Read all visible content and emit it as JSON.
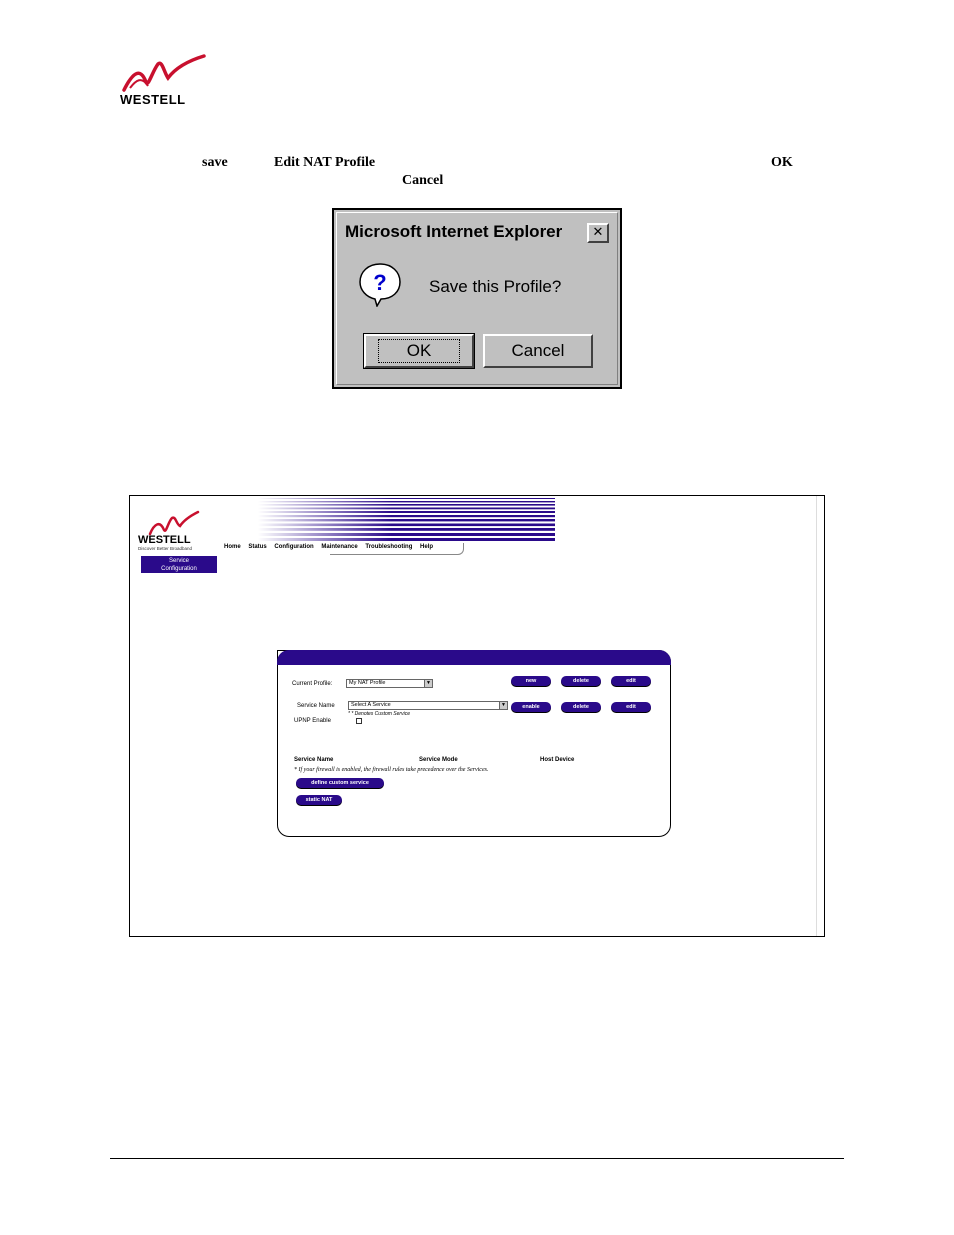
{
  "doc": {
    "logo_word": "WESTELL",
    "word_save": "save",
    "word_edit_nat": "Edit NAT Profile",
    "word_ok": "OK",
    "word_cancel": "Cancel"
  },
  "dialog": {
    "title": "Microsoft Internet Explorer",
    "close_glyph": "✕",
    "message": "Save this Profile?",
    "ok_label": "OK",
    "cancel_label": "Cancel"
  },
  "screenshot": {
    "logo_word": "WESTELL",
    "logo_tagline": "Discover Better Broadband",
    "nav": [
      "Home",
      "Status",
      "Configuration",
      "Maintenance",
      "Troubleshooting",
      "Help"
    ],
    "badge_line1": "Service",
    "badge_line2": "Configuration",
    "current_profile_label": "Current Profile:",
    "current_profile_value": "My NAT Profile",
    "service_name_label": "Service Name",
    "service_select_value": "Select A Service",
    "custom_note": "* * Denotes Custom Service",
    "upnp_label": "UPNP Enable",
    "btn_new": "new",
    "btn_delete_1": "delete",
    "btn_edit_1": "edit",
    "btn_enable": "enable",
    "btn_delete_2": "delete",
    "btn_edit_2": "edit",
    "col_service_name": "Service Name",
    "col_service_mode": "Service Mode",
    "col_host_device": "Host Device",
    "firewall_note": "* If your firewall is enabled, the firewall rules take precedence over the Services.",
    "btn_define_custom": "define custom service",
    "btn_static_nat": "static NAT"
  },
  "colors": {
    "brand_red": "#c8102e",
    "brand_navy": "#2a0a8a",
    "dialog_gray": "#c0c0c0"
  }
}
